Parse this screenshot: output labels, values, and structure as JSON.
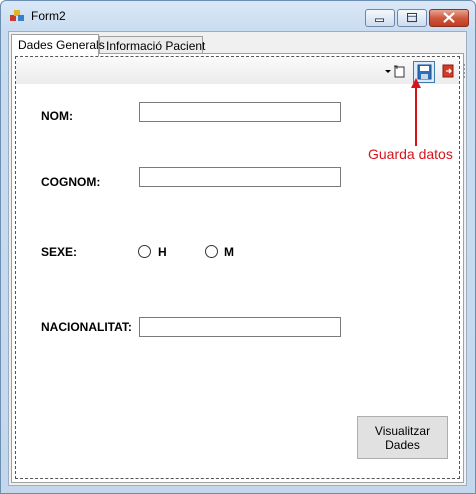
{
  "window": {
    "title": "Form2",
    "controls": {
      "minimize": "minimize",
      "maximize": "maximize",
      "close": "close"
    }
  },
  "tabs": [
    {
      "label": "Dades Generals",
      "active": true
    },
    {
      "label": "Informació Pacient",
      "active": false
    }
  ],
  "toolbar": {
    "items": [
      "dropdown-arrow-icon",
      "new-icon",
      "save-icon",
      "exit-icon"
    ]
  },
  "form": {
    "nom_label": "NOM:",
    "nom_value": "",
    "cognom_label": "COGNOM:",
    "cognom_value": "",
    "sexe_label": "SEXE:",
    "sexe_options": [
      "H",
      "M"
    ],
    "nacionalitat_label": "NACIONALITAT:",
    "nacionalitat_value": "",
    "visualitzar_button": "Visualitzar\nDades"
  },
  "annotation": {
    "text": "Guarda datos",
    "color": "#d8141b"
  }
}
